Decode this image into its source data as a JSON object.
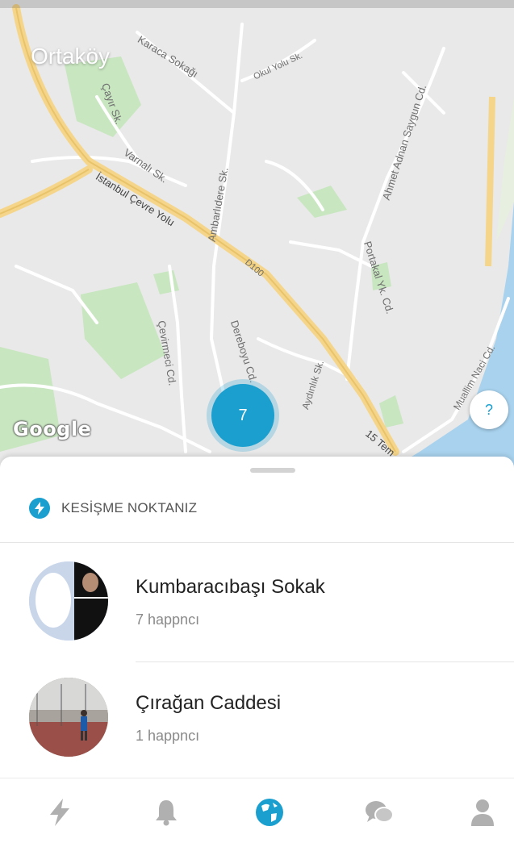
{
  "map": {
    "area_title": "Ortaköy",
    "attribution": "Google",
    "cluster_count": "7",
    "help_label": "?",
    "streets": [
      "Karaca Sokağı",
      "Okul Yolu Sk.",
      "Çayır Sk.",
      "Varnalı Sk.",
      "İstanbul Çevre Yolu",
      "Ambarlıdere Sk.",
      "Ahmet Adnan Saygun Cd.",
      "Portakal Yk. Cd.",
      "Dereboyu Cd.",
      "Aydınlık Sk.",
      "Çevirmeci Cd.",
      "Muallim Naci Cd.",
      "15 Tem",
      "D100"
    ]
  },
  "sheet": {
    "section_title": "KESİŞME NOKTANIZ",
    "items": [
      {
        "title": "Kumbaracıbaşı Sokak",
        "subtitle": "7 happncı"
      },
      {
        "title": "Çırağan Caddesi",
        "subtitle": "1 happncı"
      }
    ]
  },
  "tabs": [
    "bolt-icon",
    "bell-icon",
    "globe-icon",
    "chat-icon",
    "profile-icon"
  ],
  "colors": {
    "accent": "#1a9fcf",
    "sea": "#a8d2ee",
    "park": "#c8e6c0",
    "highway": "#f5d58a"
  }
}
